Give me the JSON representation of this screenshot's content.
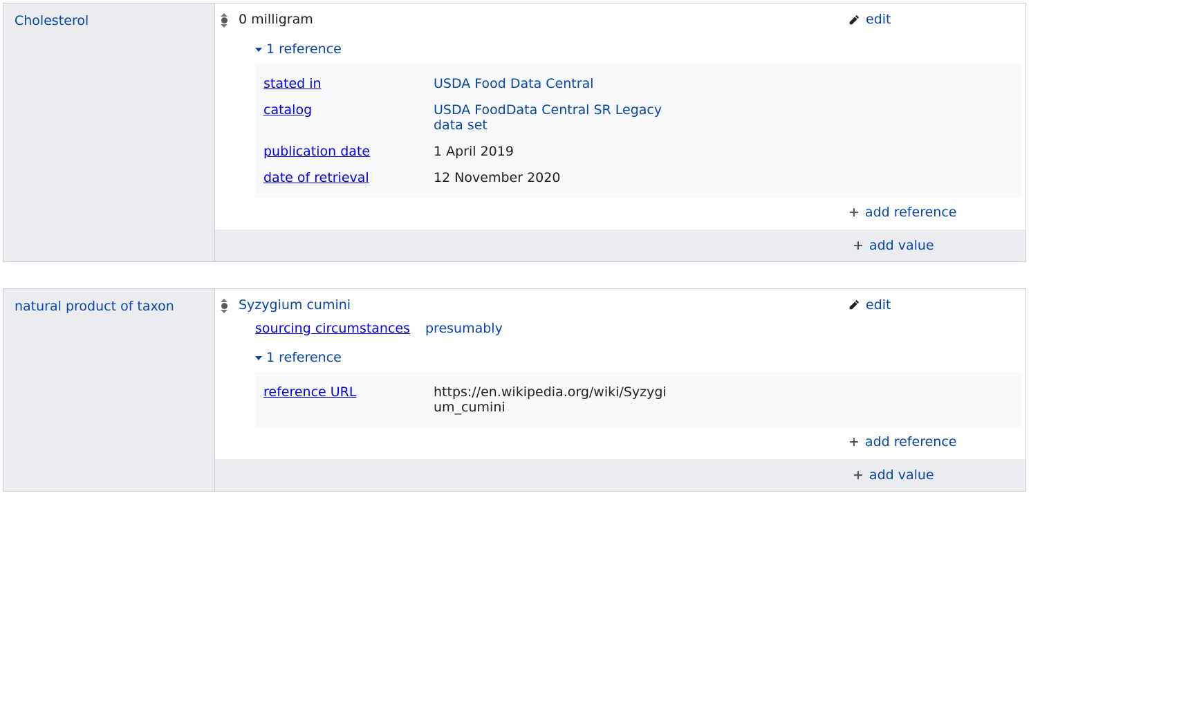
{
  "ui": {
    "edit": "edit",
    "add_reference": "add reference",
    "add_value": "add value"
  },
  "statements": [
    {
      "property": "Cholesterol",
      "value": "0 milligram",
      "value_is_link": false,
      "qualifiers": [],
      "ref_toggle": "1 reference",
      "references": [
        {
          "label": "stated in",
          "value": "USDA Food Data Central",
          "is_link": true
        },
        {
          "label": "catalog",
          "value": "USDA FoodData Central SR Legacy data set",
          "is_link": true
        },
        {
          "label": "publication date",
          "value": "1 April 2019",
          "is_link": false
        },
        {
          "label": "date of retrieval",
          "value": "12 November 2020",
          "is_link": false
        }
      ]
    },
    {
      "property": "natural product of taxon",
      "value": "Syzygium cumini",
      "value_is_link": true,
      "qualifiers": [
        {
          "label": "sourcing circumstances",
          "value": "presumably",
          "is_link": true
        }
      ],
      "ref_toggle": "1 reference",
      "references": [
        {
          "label": "reference URL",
          "value": "https://en.wikipedia.org/wiki/Syzygium_cumini",
          "is_link": false
        }
      ]
    }
  ]
}
